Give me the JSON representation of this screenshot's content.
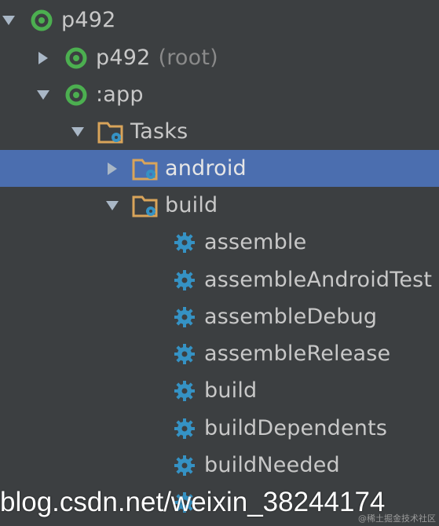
{
  "colors": {
    "background": "#3c3f41",
    "selection": "#4b6eaf",
    "gradle_green": "#4caf50",
    "folder_orange": "#d9a45a",
    "gear_blue": "#3592c4"
  },
  "tree": {
    "rows": [
      {
        "label": "p492",
        "suffix": "",
        "icon": "gradle-project-icon",
        "arrow": "expanded",
        "selected": false
      },
      {
        "label": "p492",
        "suffix": "(root)",
        "icon": "gradle-project-icon",
        "arrow": "collapsed",
        "selected": false
      },
      {
        "label": ":app",
        "suffix": "",
        "icon": "gradle-project-icon",
        "arrow": "expanded",
        "selected": false
      },
      {
        "label": "Tasks",
        "suffix": "",
        "icon": "task-folder-icon",
        "arrow": "expanded",
        "selected": false
      },
      {
        "label": "android",
        "suffix": "",
        "icon": "task-folder-icon",
        "arrow": "collapsed",
        "selected": true
      },
      {
        "label": "build",
        "suffix": "",
        "icon": "task-folder-icon",
        "arrow": "expanded",
        "selected": false
      },
      {
        "label": "assemble",
        "suffix": "",
        "icon": "gear-icon",
        "arrow": "none",
        "selected": false
      },
      {
        "label": "assembleAndroidTest",
        "suffix": "",
        "icon": "gear-icon",
        "arrow": "none",
        "selected": false
      },
      {
        "label": "assembleDebug",
        "suffix": "",
        "icon": "gear-icon",
        "arrow": "none",
        "selected": false
      },
      {
        "label": "assembleRelease",
        "suffix": "",
        "icon": "gear-icon",
        "arrow": "none",
        "selected": false
      },
      {
        "label": "build",
        "suffix": "",
        "icon": "gear-icon",
        "arrow": "none",
        "selected": false
      },
      {
        "label": "buildDependents",
        "suffix": "",
        "icon": "gear-icon",
        "arrow": "none",
        "selected": false
      },
      {
        "label": "buildNeeded",
        "suffix": "",
        "icon": "gear-icon",
        "arrow": "none",
        "selected": false
      }
    ]
  },
  "watermark": {
    "text": "blog.csdn.net/weixin_38244174",
    "small": "@稀土掘金技术社区"
  }
}
